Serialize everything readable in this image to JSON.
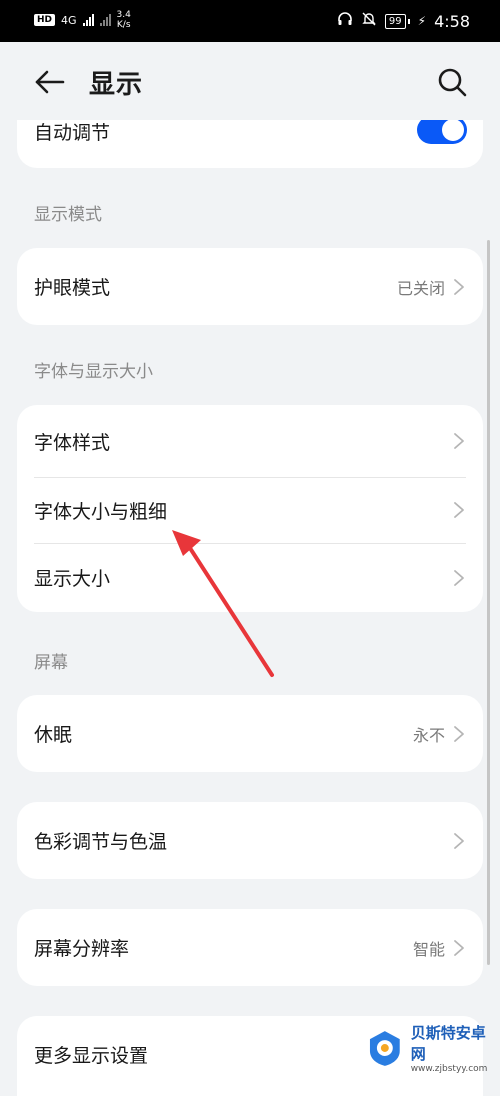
{
  "status_bar": {
    "hd": "HD",
    "net1": "4G",
    "speed_value": "3.4",
    "speed_unit": "K/s",
    "battery": "99",
    "time": "4:58"
  },
  "header": {
    "title": "显示",
    "back_icon": "arrow-left-icon",
    "search_icon": "search-icon"
  },
  "top_card": {
    "label": "自动调节",
    "toggle_on": true
  },
  "sections": {
    "display_mode": "显示模式",
    "font_display_size": "字体与显示大小",
    "screen": "屏幕"
  },
  "rows": {
    "eye_comfort": {
      "label": "护眼模式",
      "value": "已关闭"
    },
    "font_style": {
      "label": "字体样式"
    },
    "font_size_weight": {
      "label": "字体大小与粗细"
    },
    "display_size": {
      "label": "显示大小"
    },
    "sleep": {
      "label": "休眠",
      "value": "永不"
    },
    "color_temp": {
      "label": "色彩调节与色温"
    },
    "resolution": {
      "label": "屏幕分辨率",
      "value": "智能"
    },
    "more_display": {
      "label": "更多显示设置"
    }
  },
  "watermark": {
    "brand": "贝斯特安卓网",
    "url": "www.zjbstyy.com"
  },
  "colors": {
    "accent": "#0a59f7",
    "background": "#f1f3f5",
    "annotation_arrow": "#e8363a"
  }
}
